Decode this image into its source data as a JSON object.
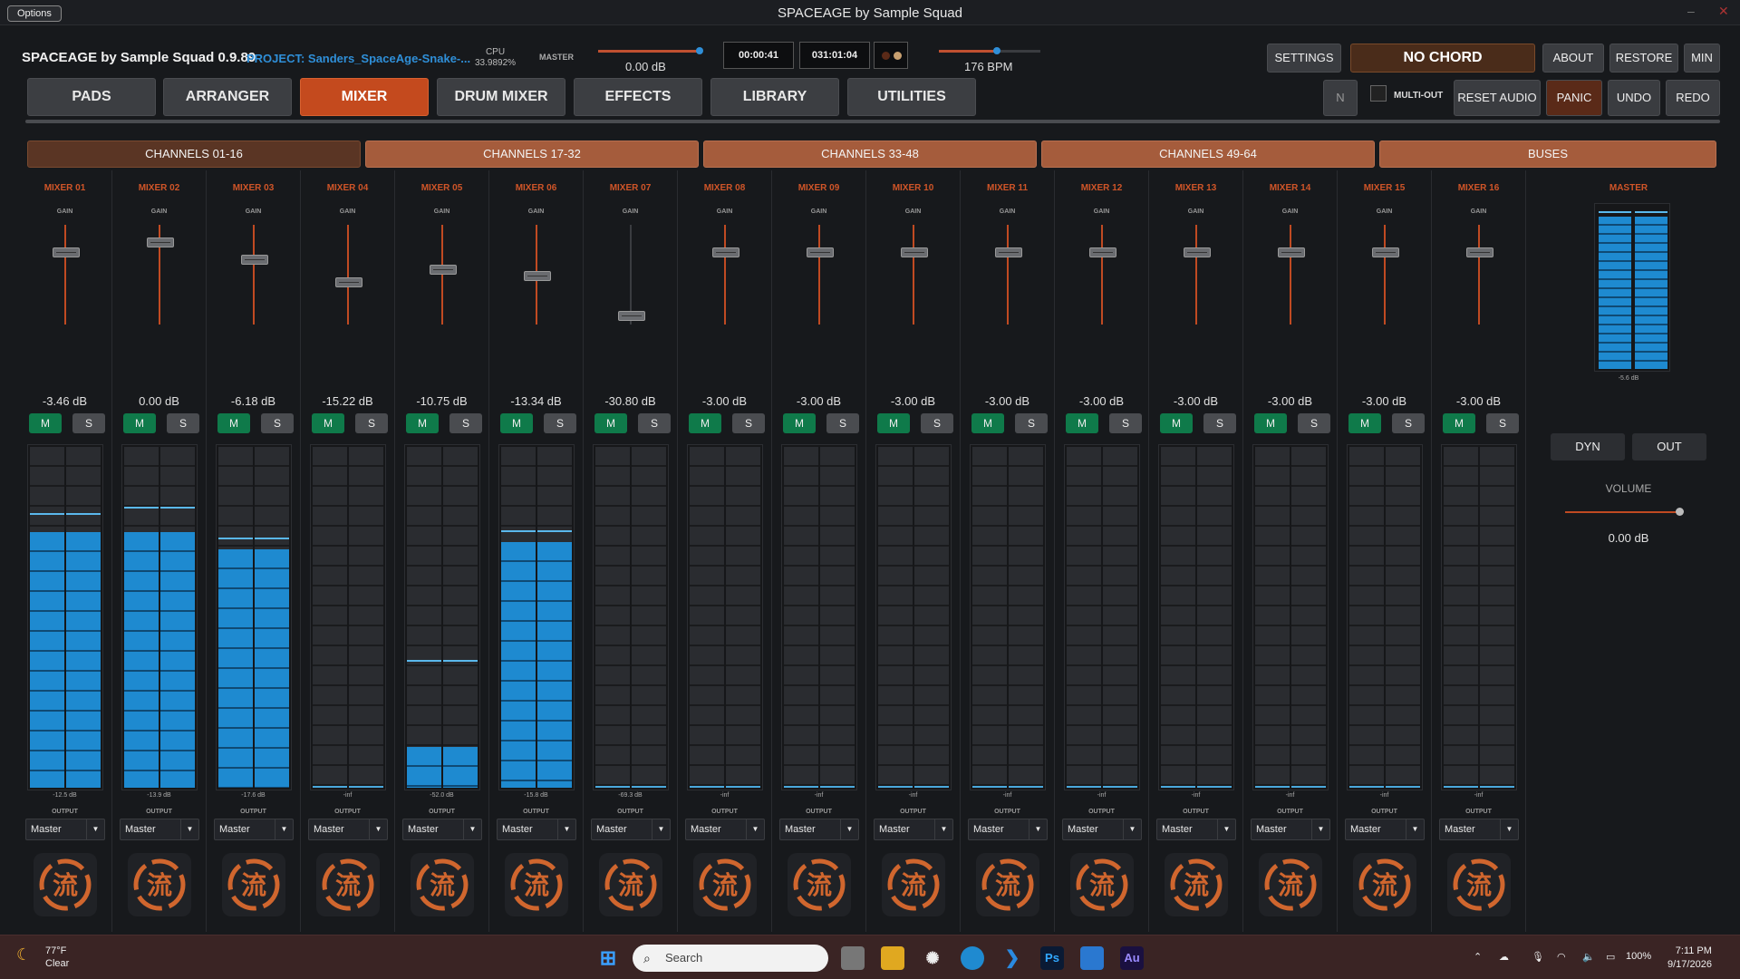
{
  "titlebar": {
    "options": "Options",
    "title": "SPACEAGE by Sample Squad",
    "minimize": "–",
    "close": "✕"
  },
  "header": {
    "app_title": "SPACEAGE by Sample Squad 0.9.89",
    "project": "PROJECT: Sanders_SpaceAge-Snake-...",
    "cpu_label": "CPU",
    "cpu_value": "33.9892%",
    "master_label": "MASTER",
    "master_db": "0.00 dB",
    "time1": "00:00:41",
    "time2": "031:01:04",
    "bpm": "176 BPM",
    "settings": "SETTINGS",
    "chord": "NO CHORD",
    "about": "ABOUT",
    "restore": "RESTORE",
    "min": "MIN",
    "n": "N",
    "multi_out": "MULTI-OUT",
    "reset_audio": "RESET AUDIO",
    "panic": "PANIC",
    "undo": "UNDO",
    "redo": "REDO"
  },
  "tabs": [
    "PADS",
    "ARRANGER",
    "MIXER",
    "DRUM MIXER",
    "EFFECTS",
    "LIBRARY",
    "UTILITIES"
  ],
  "active_tab": "MIXER",
  "channel_groups": [
    "CHANNELS 01-16",
    "CHANNELS 17-32",
    "CHANNELS 33-48",
    "CHANNELS 49-64",
    "BUSES"
  ],
  "strip_labels": {
    "gain": "GAIN",
    "mute": "M",
    "solo": "S",
    "output": "OUTPUT",
    "logo_glyph": "流"
  },
  "channels": [
    {
      "name": "MIXER 01",
      "db": "-3.46 dB",
      "peak": "-12.5 dB",
      "output": "Master",
      "fader": 0.72,
      "level": 0.75,
      "hold": 0.8
    },
    {
      "name": "MIXER 02",
      "db": "0.00 dB",
      "peak": "-13.9 dB",
      "output": "Master",
      "fader": 0.82,
      "level": 0.75,
      "hold": 0.82
    },
    {
      "name": "MIXER 03",
      "db": "-6.18 dB",
      "peak": "-17.6 dB",
      "output": "Master",
      "fader": 0.65,
      "level": 0.7,
      "hold": 0.73
    },
    {
      "name": "MIXER 04",
      "db": "-15.22 dB",
      "peak": "-inf",
      "output": "Master",
      "fader": 0.42,
      "level": 0,
      "hold": 0
    },
    {
      "name": "MIXER 05",
      "db": "-10.75 dB",
      "peak": "-52.0 dB",
      "output": "Master",
      "fader": 0.55,
      "level": 0.12,
      "hold": 0.37
    },
    {
      "name": "MIXER 06",
      "db": "-13.34 dB",
      "peak": "-15.8 dB",
      "output": "Master",
      "fader": 0.48,
      "level": 0.72,
      "hold": 0.75
    },
    {
      "name": "MIXER 07",
      "db": "-30.80 dB",
      "peak": "-69.3 dB",
      "output": "Master",
      "fader": 0.08,
      "level": 0,
      "hold": 0
    },
    {
      "name": "MIXER 08",
      "db": "-3.00 dB",
      "peak": "-inf",
      "output": "Master",
      "fader": 0.72,
      "level": 0,
      "hold": 0
    },
    {
      "name": "MIXER 09",
      "db": "-3.00 dB",
      "peak": "-inf",
      "output": "Master",
      "fader": 0.72,
      "level": 0,
      "hold": 0
    },
    {
      "name": "MIXER 10",
      "db": "-3.00 dB",
      "peak": "-inf",
      "output": "Master",
      "fader": 0.72,
      "level": 0,
      "hold": 0
    },
    {
      "name": "MIXER 11",
      "db": "-3.00 dB",
      "peak": "-inf",
      "output": "Master",
      "fader": 0.72,
      "level": 0,
      "hold": 0
    },
    {
      "name": "MIXER 12",
      "db": "-3.00 dB",
      "peak": "-inf",
      "output": "Master",
      "fader": 0.72,
      "level": 0,
      "hold": 0
    },
    {
      "name": "MIXER 13",
      "db": "-3.00 dB",
      "peak": "-inf",
      "output": "Master",
      "fader": 0.72,
      "level": 0,
      "hold": 0
    },
    {
      "name": "MIXER 14",
      "db": "-3.00 dB",
      "peak": "-inf",
      "output": "Master",
      "fader": 0.72,
      "level": 0,
      "hold": 0
    },
    {
      "name": "MIXER 15",
      "db": "-3.00 dB",
      "peak": "-inf",
      "output": "Master",
      "fader": 0.72,
      "level": 0,
      "hold": 0
    },
    {
      "name": "MIXER 16",
      "db": "-3.00 dB",
      "peak": "-inf",
      "output": "Master",
      "fader": 0.72,
      "level": 0,
      "hold": 0
    }
  ],
  "master": {
    "name": "MASTER",
    "peak": "-5.6 dB",
    "dyn": "DYN",
    "out": "OUT",
    "volume_label": "VOLUME",
    "volume_db": "0.00 dB",
    "volume_value": 0.97
  },
  "taskbar": {
    "temp": "77°F",
    "condition": "Clear",
    "search": "Search",
    "ps": "Ps",
    "au": "Au",
    "battery": "100%",
    "time": "7:11 PM",
    "date": "9/17/2026"
  },
  "colors": {
    "accent": "#c44a1e",
    "meter": "#1e8ad0",
    "mute": "#0f7a4a"
  }
}
